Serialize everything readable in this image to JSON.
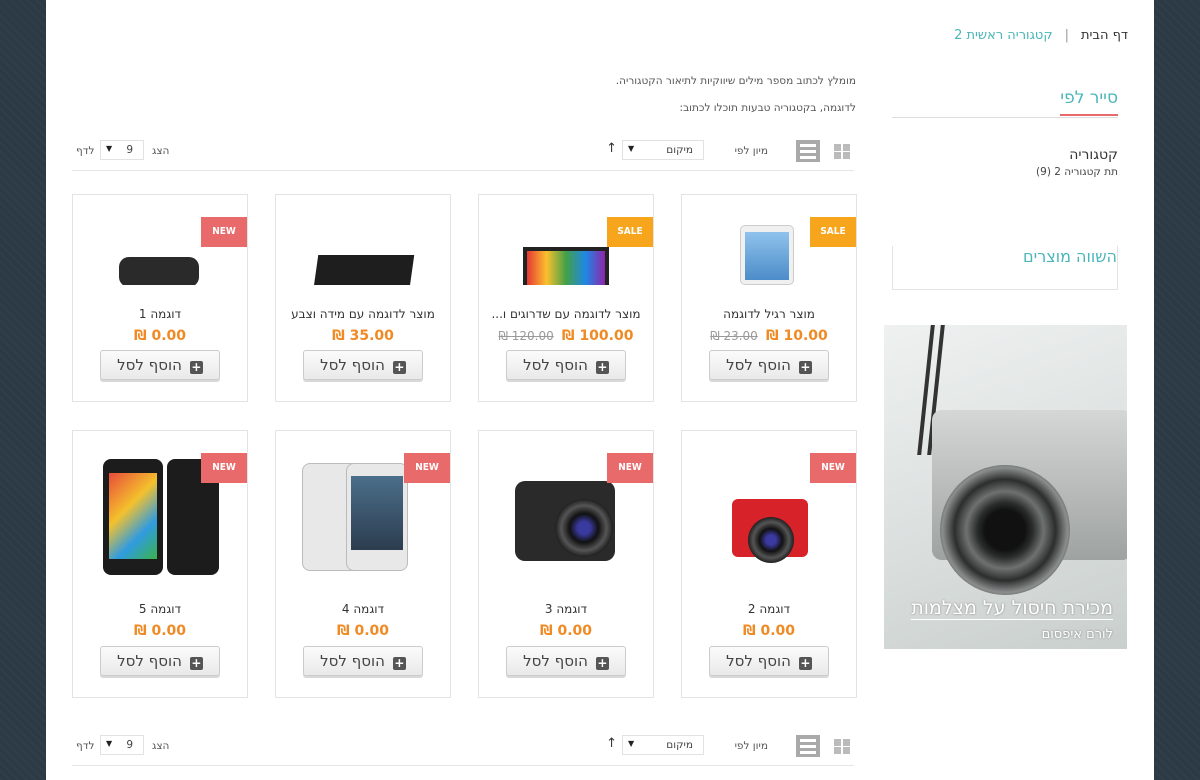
{
  "breadcrumb": {
    "home": "דף הבית",
    "separator": "|",
    "current": "קטגוריה ראשית 2"
  },
  "description": {
    "line1": "מומלץ לכתוב מספר מילים שיווקיות לתיאור הקטגוריה.",
    "line2": "לדוגמה, בקטגוריה טבעות תוכלו לכתוב:"
  },
  "sidebar": {
    "browse_title": "סייר לפי",
    "category_title": "קטגוריה",
    "subcategory": "תת קטגוריה 2 (9)",
    "compare_title": "השווה מוצרים",
    "banner": {
      "title": "מכירת חיסול על מצלמות",
      "subtitle": "לורם איפסום"
    }
  },
  "toolbar": {
    "sort_label": "מיון לפי",
    "sort_value": "מיקום",
    "sort_direction": "↑",
    "show_label": "הצג",
    "show_value": "9",
    "per_page": "לדף",
    "dropdown_arrow": "▼"
  },
  "add_to_cart_label": "הוסף לסל",
  "products": [
    {
      "name": "מוצר רגיל לדוגמה",
      "price": "10.00 ₪",
      "old_price": "23.00 ₪",
      "badge": "SALE"
    },
    {
      "name": "מוצר לדוגמה עם שדרוגים ו...",
      "price": "100.00 ₪",
      "old_price": "120.00 ₪",
      "badge": "SALE"
    },
    {
      "name": "מוצר לדוגמה עם מידה וצבע",
      "price": "35.00 ₪",
      "old_price": "",
      "badge": ""
    },
    {
      "name": "דוגמה 1",
      "price": "0.00 ₪",
      "old_price": "",
      "badge": "NEW"
    },
    {
      "name": "דוגמה 2",
      "price": "0.00 ₪",
      "old_price": "",
      "badge": "NEW"
    },
    {
      "name": "דוגמה 3",
      "price": "0.00 ₪",
      "old_price": "",
      "badge": "NEW"
    },
    {
      "name": "דוגמה 4",
      "price": "0.00 ₪",
      "old_price": "",
      "badge": "NEW"
    },
    {
      "name": "דוגמה 5",
      "price": "0.00 ₪",
      "old_price": "",
      "badge": "NEW"
    }
  ],
  "colors": {
    "accent": "#4ab6b8",
    "new_badge": "#e86a6a",
    "sale_badge": "#f6a51d",
    "price": "#f08a24"
  }
}
